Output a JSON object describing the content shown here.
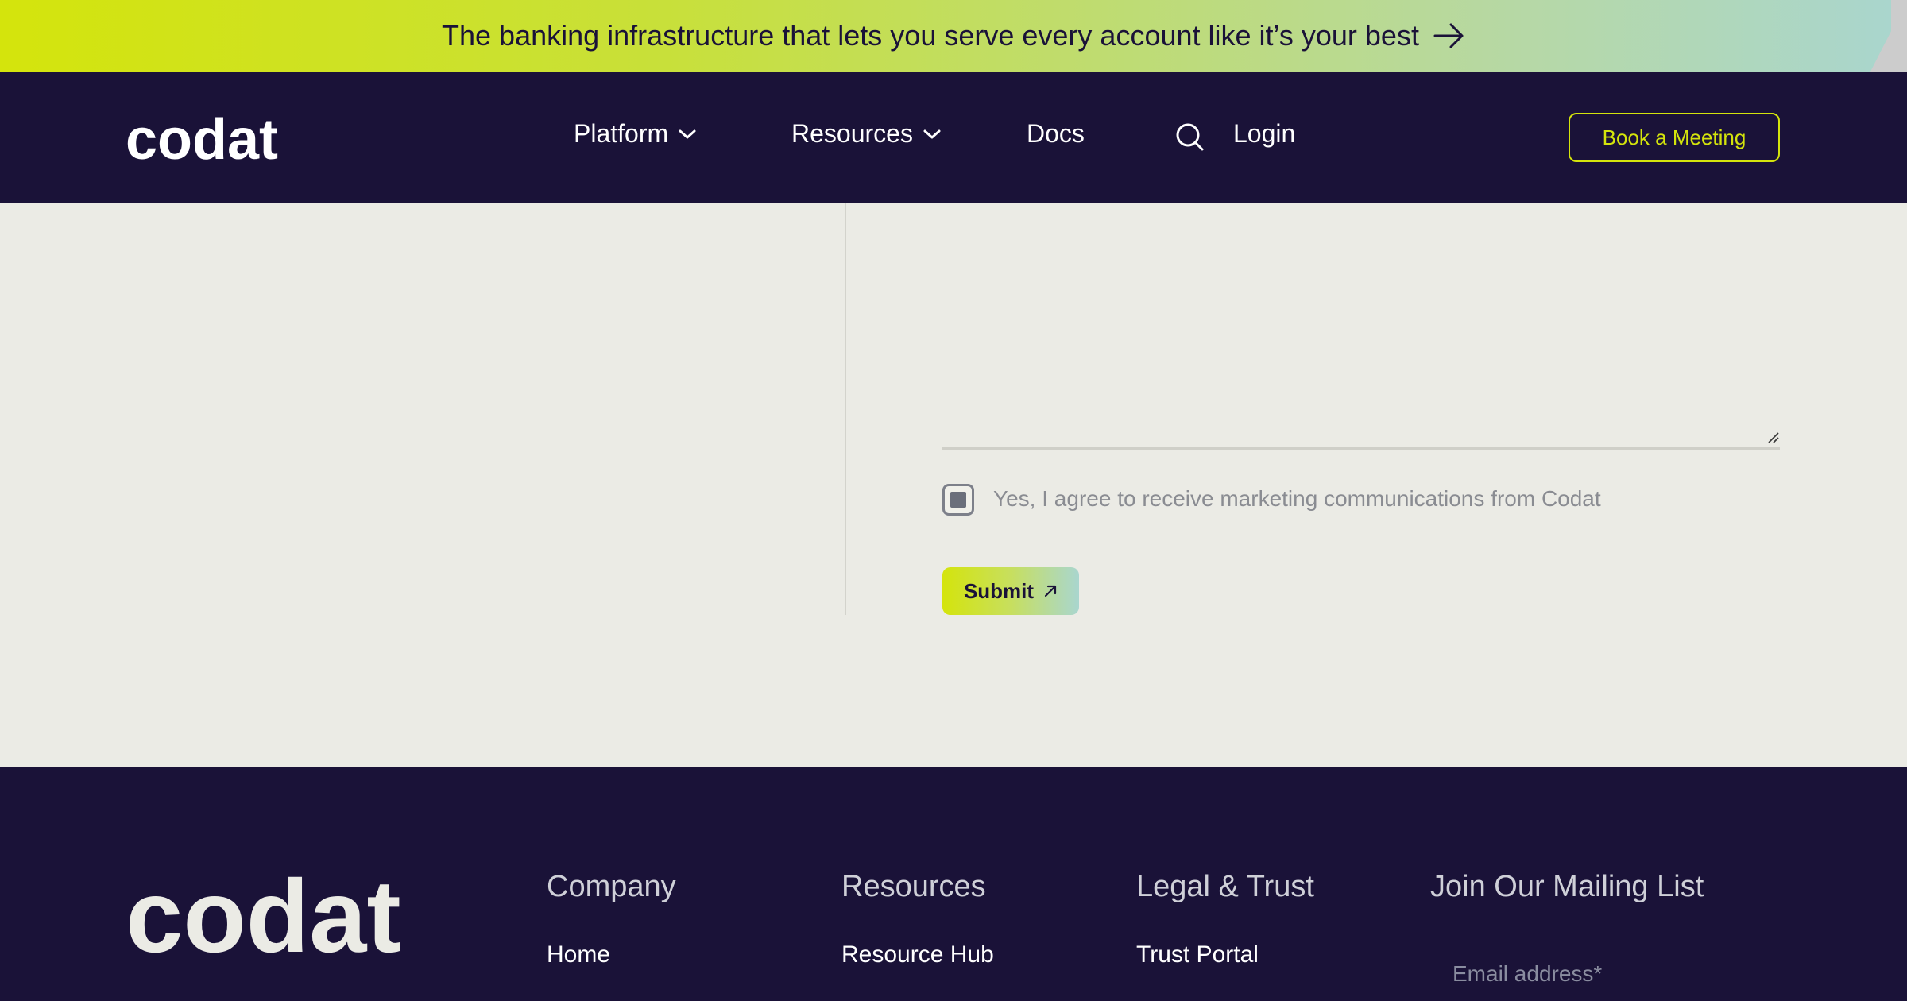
{
  "banner": {
    "text": "The banking infrastructure that lets you serve every account like it’s your best"
  },
  "header": {
    "logo_text": "codat",
    "nav": {
      "platform": "Platform",
      "resources": "Resources",
      "docs": "Docs",
      "login": "Login"
    },
    "book_button": "Book a Meeting"
  },
  "form": {
    "consent_label": "Yes, I agree to receive marketing communications from Codat",
    "consent_checked": false,
    "submit_label": "Submit"
  },
  "footer": {
    "logo_text": "codat",
    "columns": [
      {
        "heading": "Company",
        "first_link": "Home"
      },
      {
        "heading": "Resources",
        "first_link": "Resource Hub"
      },
      {
        "heading": "Legal & Trust",
        "first_link": "Trust Portal"
      },
      {
        "heading": "Join Our Mailing List"
      }
    ],
    "email_placeholder": "Email address*"
  },
  "colors": {
    "navy": "#1a1238",
    "lime": "#d4e40c",
    "page_bg": "#ebebe5"
  }
}
